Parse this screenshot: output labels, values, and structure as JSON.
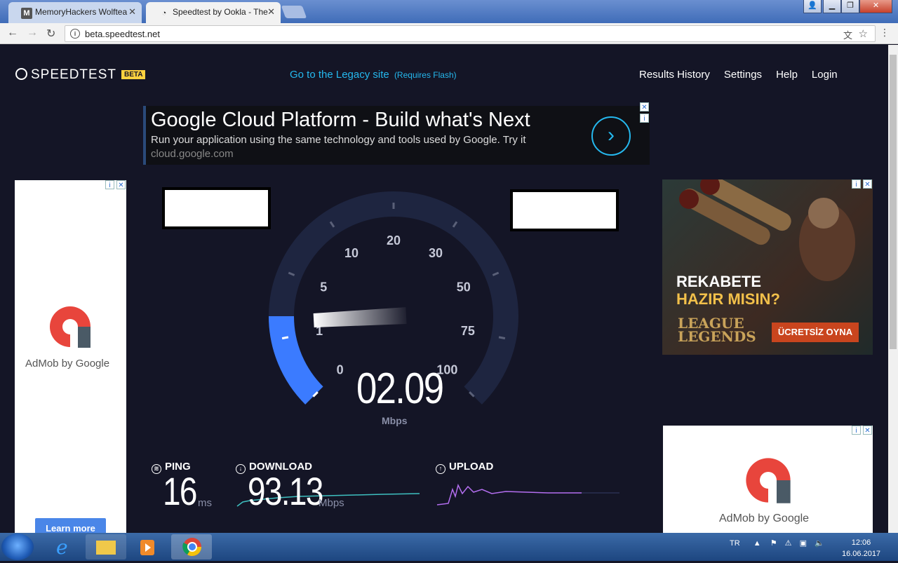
{
  "browser": {
    "tabs": [
      {
        "title": "MemoryHackers Wolftea",
        "icon": "memoryhackers-favicon"
      },
      {
        "title": "Speedtest by Ookla - The",
        "icon": "speedtest-favicon"
      }
    ],
    "url": "beta.speedtest.net"
  },
  "site": {
    "logo": "SPEEDTEST",
    "badge": "BETA",
    "legacy_link": "Go to the Legacy site",
    "legacy_note": "(Requires Flash)",
    "nav": [
      "Results History",
      "Settings",
      "Help",
      "Login"
    ]
  },
  "ad_top": {
    "headline": "Google Cloud Platform - Build what's Next",
    "subline": "Run your application using the same technology and tools used by Google. Try it",
    "domain": "cloud.google.com"
  },
  "ad_left": {
    "brand": "AdMob by Google",
    "button": "Learn more"
  },
  "ad_right_top": {
    "line1": "REKABETE",
    "line2": "HAZIR MISIN?",
    "logo1": "LEAGUE",
    "logo2": "LEGENDS",
    "cta": "ÜCRETSİZ OYNA"
  },
  "ad_right_bottom": {
    "brand": "AdMob by Google"
  },
  "gauge": {
    "labels": [
      "0",
      "1",
      "5",
      "10",
      "20",
      "30",
      "50",
      "75",
      "100"
    ],
    "reading": "02.09",
    "unit": "Mbps",
    "accent": "#3b7bff"
  },
  "results": {
    "ping": {
      "label": "PING",
      "value": "16",
      "unit": "ms"
    },
    "download": {
      "label": "DOWNLOAD",
      "value": "93.13",
      "unit": "Mbps"
    },
    "upload": {
      "label": "UPLOAD"
    }
  },
  "taskbar": {
    "lang": "TR",
    "time": "12:06",
    "date": "16.06.2017"
  }
}
